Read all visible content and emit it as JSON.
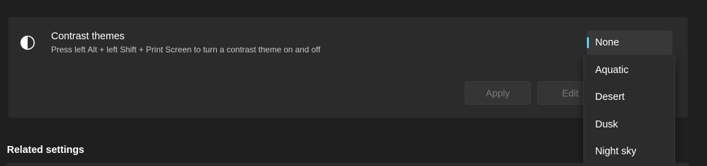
{
  "contrast_themes": {
    "title": "Contrast themes",
    "description": "Press left Alt + left Shift + Print Screen to turn a contrast theme on and off",
    "icon": "contrast-icon",
    "apply_label": "Apply",
    "edit_label": "Edit",
    "selected": "None",
    "options": [
      "None",
      "Aquatic",
      "Desert",
      "Dusk",
      "Night sky"
    ]
  },
  "related_settings": {
    "heading": "Related settings"
  },
  "colors": {
    "background": "#1f1f1f",
    "card": "#2b2b2b",
    "accent": "#60cdff"
  }
}
